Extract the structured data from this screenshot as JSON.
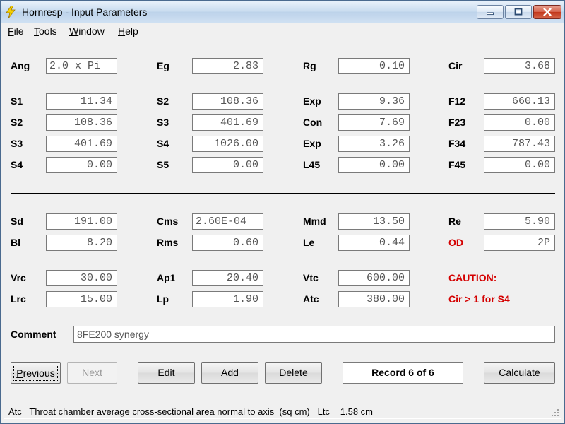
{
  "window": {
    "title": "Hornresp - Input Parameters"
  },
  "menu": [
    {
      "mnemonic": "F",
      "rest": "ile"
    },
    {
      "mnemonic": "T",
      "rest": "ools"
    },
    {
      "mnemonic": "W",
      "rest": "indow"
    },
    {
      "mnemonic": "H",
      "rest": "elp"
    }
  ],
  "params": {
    "Ang": {
      "label": "Ang",
      "value": "2.0 x Pi"
    },
    "Eg": {
      "label": "Eg",
      "value": "2.83"
    },
    "Rg": {
      "label": "Rg",
      "value": "0.10"
    },
    "Cir": {
      "label": "Cir",
      "value": "3.68"
    },
    "S1": {
      "label": "S1",
      "value": "11.34"
    },
    "S2a": {
      "label": "S2",
      "value": "108.36"
    },
    "Exp1": {
      "label": "Exp",
      "value": "9.36"
    },
    "F12": {
      "label": "F12",
      "value": "660.13"
    },
    "S2b": {
      "label": "S2",
      "value": "108.36"
    },
    "S3a": {
      "label": "S3",
      "value": "401.69"
    },
    "Con": {
      "label": "Con",
      "value": "7.69"
    },
    "F23": {
      "label": "F23",
      "value": "0.00"
    },
    "S3b": {
      "label": "S3",
      "value": "401.69"
    },
    "S4a": {
      "label": "S4",
      "value": "1026.00"
    },
    "Exp2": {
      "label": "Exp",
      "value": "3.26"
    },
    "F34": {
      "label": "F34",
      "value": "787.43"
    },
    "S4b": {
      "label": "S4",
      "value": "0.00"
    },
    "S5": {
      "label": "S5",
      "value": "0.00"
    },
    "L45": {
      "label": "L45",
      "value": "0.00"
    },
    "F45": {
      "label": "F45",
      "value": "0.00"
    },
    "Sd": {
      "label": "Sd",
      "value": "191.00"
    },
    "Cms": {
      "label": "Cms",
      "value": "2.60E-04"
    },
    "Mmd": {
      "label": "Mmd",
      "value": "13.50"
    },
    "Re": {
      "label": "Re",
      "value": "5.90"
    },
    "Bl": {
      "label": "Bl",
      "value": "8.20"
    },
    "Rms": {
      "label": "Rms",
      "value": "0.60"
    },
    "Le": {
      "label": "Le",
      "value": "0.44"
    },
    "OD": {
      "label": "OD",
      "value": "2P"
    },
    "Vrc": {
      "label": "Vrc",
      "value": "30.00"
    },
    "Ap1": {
      "label": "Ap1",
      "value": "20.40"
    },
    "Vtc": {
      "label": "Vtc",
      "value": "600.00"
    },
    "Lrc": {
      "label": "Lrc",
      "value": "15.00"
    },
    "Lp": {
      "label": "Lp",
      "value": "1.90"
    },
    "Atc": {
      "label": "Atc",
      "value": "380.00"
    }
  },
  "caution": {
    "title": "CAUTION:",
    "message": "Cir > 1 for S4"
  },
  "comment": {
    "label": "Comment",
    "value": "8FE200 synergy"
  },
  "buttons": {
    "previous": {
      "mnemonic": "P",
      "rest": "revious"
    },
    "next": {
      "mnemonic": "N",
      "rest": "ext"
    },
    "edit": {
      "mnemonic": "E",
      "rest": "dit"
    },
    "add": {
      "mnemonic": "A",
      "rest": "dd"
    },
    "delete": {
      "mnemonic": "D",
      "rest": "elete"
    },
    "calculate": {
      "mnemonic": "C",
      "rest": "alculate"
    }
  },
  "record": "Record 6 of 6",
  "status": "Atc   Throat chamber average cross-sectional area normal to axis  (sq cm)   Ltc = 1.58 cm",
  "colors": {
    "warning": "#d40000",
    "titlebar": "#c8dbef",
    "close": "#c2361b"
  },
  "icons": [
    "lightning-icon",
    "minimize-icon",
    "maximize-icon",
    "close-icon",
    "resize-grip-icon"
  ]
}
